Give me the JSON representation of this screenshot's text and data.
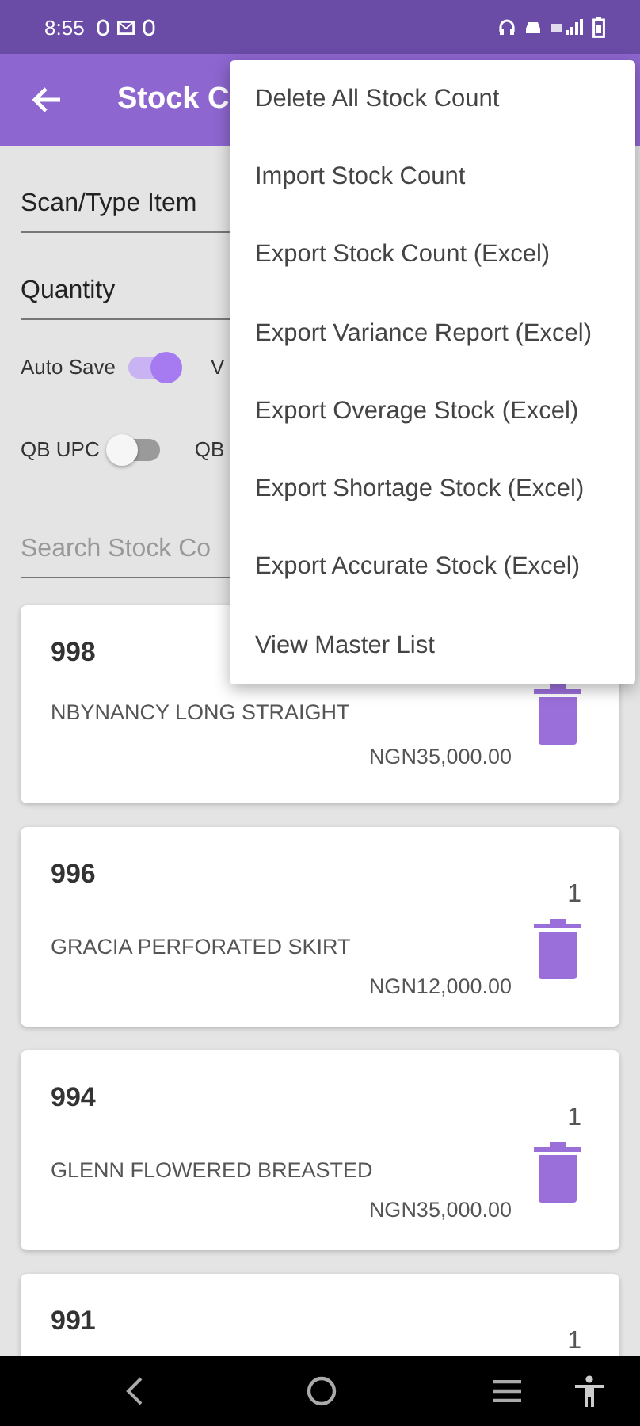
{
  "status_bar": {
    "time": "8:55"
  },
  "app_bar": {
    "title": "Stock C"
  },
  "form": {
    "scan_field": {
      "placeholder": "Scan/Type Item"
    },
    "quantity_field": {
      "placeholder": "Quantity"
    },
    "switches": [
      {
        "label": "Auto Save",
        "on": true,
        "trailing_label": "V"
      },
      {
        "label": "QB UPC",
        "on": false,
        "trailing_label": "QB"
      }
    ],
    "search_field": {
      "placeholder": "Search Stock Co"
    }
  },
  "items": [
    {
      "code": "998",
      "name": "NBYNANCY LONG STRAIGHT",
      "price": "NGN35,000.00"
    },
    {
      "code": "996",
      "quantity": "1",
      "name": "GRACIA PERFORATED SKIRT",
      "price": "NGN12,000.00"
    },
    {
      "code": "994",
      "quantity": "1",
      "name": "GLENN FLOWERED BREASTED",
      "price": "NGN35,000.00"
    },
    {
      "code": "991",
      "quantity": "1"
    }
  ],
  "menu": [
    "Delete All Stock Count",
    "Import Stock Count",
    "Export Stock Count (Excel)",
    "Export Variance Report (Excel)",
    "Export Overage Stock (Excel)",
    "Export Shortage Stock (Excel)",
    "Export Accurate Stock (Excel)",
    "View Master List"
  ]
}
